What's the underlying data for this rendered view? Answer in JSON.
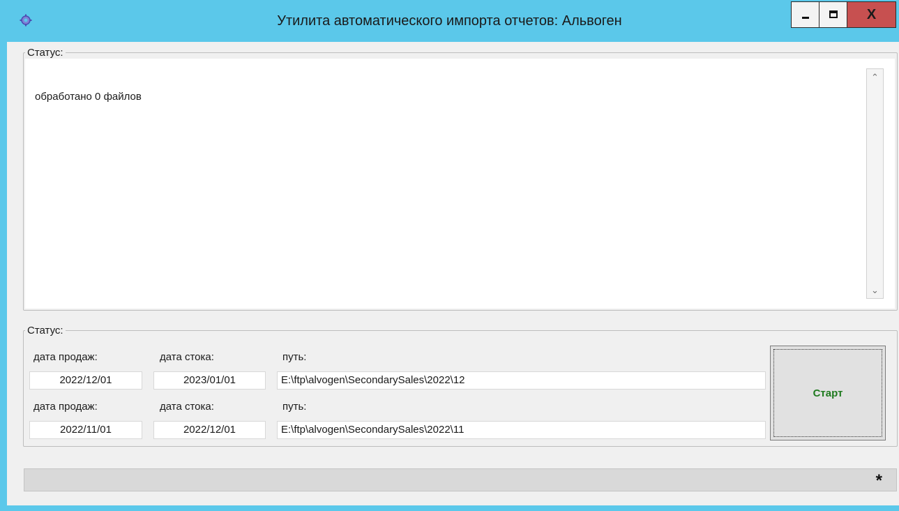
{
  "window": {
    "title": "Утилита автоматического импорта отчетов: Альвоген",
    "icon": "gear-app-icon",
    "controls": {
      "minimize_icon": "minimize-icon",
      "maximize_icon": "maximize-icon",
      "close_label": "X"
    }
  },
  "log_group": {
    "legend": "Статус:",
    "text": "обработано 0 файлов"
  },
  "params_group": {
    "legend": "Статус:",
    "rows": [
      {
        "sales_date_label": "дата продаж:",
        "stock_date_label": "дата стока:",
        "path_label": "путь:",
        "sales_date": "2022/12/01",
        "stock_date": "2023/01/01",
        "path": "E:\\ftp\\alvogen\\SecondarySales\\2022\\12"
      },
      {
        "sales_date_label": "дата продаж:",
        "stock_date_label": "дата стока:",
        "path_label": "путь:",
        "sales_date": "2022/11/01",
        "stock_date": "2022/12/01",
        "path": "E:\\ftp\\alvogen\\SecondarySales\\2022\\11"
      }
    ],
    "start_button": "Старт"
  },
  "progress": {
    "value_fraction": 0,
    "indicator": "*"
  },
  "colors": {
    "title_bar": "#5bc8ea",
    "close_button": "#c75050",
    "start_text": "#1f7a1f",
    "progress_fill": "#06b025"
  }
}
